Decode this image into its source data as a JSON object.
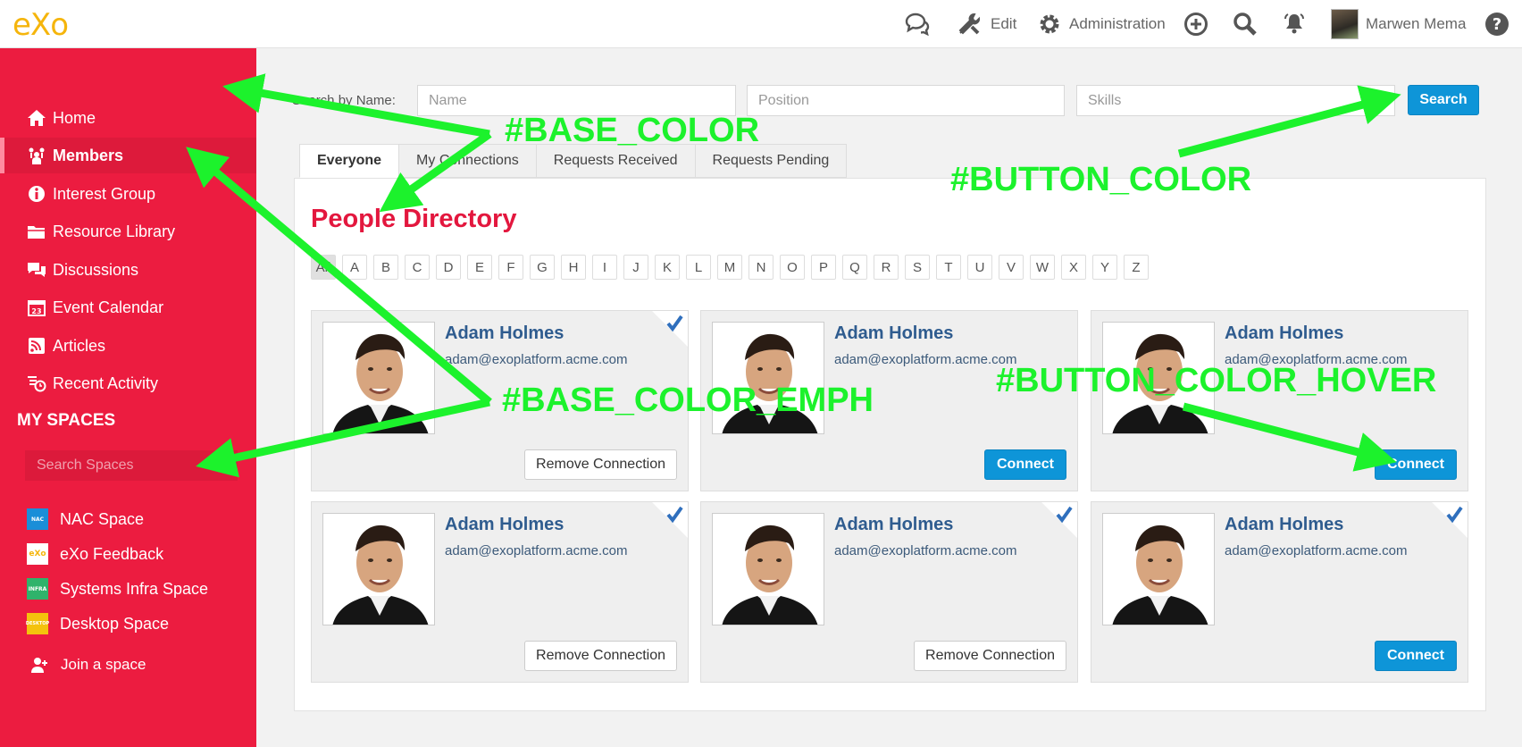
{
  "topbar": {
    "logo": "eXo",
    "edit_label": "Edit",
    "admin_label": "Administration",
    "user_name": "Marwen Mema",
    "icons": [
      "chat-icon",
      "tools-icon",
      "gear-icon",
      "plus-circle-icon",
      "search-icon",
      "bell-icon",
      "avatar",
      "help-icon"
    ]
  },
  "sidebar": {
    "items": [
      {
        "label": "Home",
        "icon": "home-icon"
      },
      {
        "label": "Members",
        "icon": "members-icon",
        "active": true
      },
      {
        "label": "Interest Group",
        "icon": "info-icon"
      },
      {
        "label": "Resource Library",
        "icon": "folder-icon"
      },
      {
        "label": "Discussions",
        "icon": "discussion-icon"
      },
      {
        "label": "Event Calendar",
        "icon": "calendar-icon"
      },
      {
        "label": "Articles",
        "icon": "rss-icon"
      },
      {
        "label": "Recent Activity",
        "icon": "activity-icon"
      }
    ],
    "my_spaces_title": "MY SPACES",
    "search_placeholder": "Search Spaces",
    "spaces": [
      {
        "label": "NAC Space",
        "badge": "NAC",
        "color": "#1a8ed8"
      },
      {
        "label": "eXo Feedback",
        "badge": "eXo",
        "color": "#ffffff"
      },
      {
        "label": "Systems Infra Space",
        "badge": "INFRA",
        "color": "#2fb36b"
      },
      {
        "label": "Desktop Space",
        "badge": "DESKTOP",
        "color": "#f4c20d"
      }
    ],
    "join_label": "Join a space"
  },
  "search": {
    "label": "Search by Name:",
    "name_placeholder": "Name",
    "position_placeholder": "Position",
    "skills_placeholder": "Skills",
    "button": "Search"
  },
  "tabs": [
    {
      "label": "Everyone",
      "active": true
    },
    {
      "label": "My Connections"
    },
    {
      "label": "Requests Received"
    },
    {
      "label": "Requests Pending"
    }
  ],
  "directory": {
    "title": "People Directory",
    "letters": [
      "All",
      "A",
      "B",
      "C",
      "D",
      "E",
      "F",
      "G",
      "H",
      "I",
      "J",
      "K",
      "L",
      "M",
      "N",
      "O",
      "P",
      "Q",
      "R",
      "S",
      "T",
      "U",
      "V",
      "W",
      "X",
      "Y",
      "Z"
    ],
    "people": [
      {
        "name": "Adam Holmes",
        "email": "adam@exoplatform.acme.com",
        "connected": true,
        "button": "Remove Connection"
      },
      {
        "name": "Adam Holmes",
        "email": "adam@exoplatform.acme.com",
        "connected": false,
        "button": "Connect"
      },
      {
        "name": "Adam Holmes",
        "email": "adam@exoplatform.acme.com",
        "connected": false,
        "button": "Connect"
      },
      {
        "name": "Adam Holmes",
        "email": "adam@exoplatform.acme.com",
        "connected": true,
        "button": "Remove Connection"
      },
      {
        "name": "Adam Holmes",
        "email": "adam@exoplatform.acme.com",
        "connected": true,
        "button": "Remove Connection"
      },
      {
        "name": "Adam Holmes",
        "email": "adam@exoplatform.acme.com",
        "connected": true,
        "button": "Connect"
      }
    ]
  },
  "annotations": {
    "base_color": "#BASE_COLOR",
    "button_color": "#BUTTON_COLOR",
    "base_color_emph": "#BASE_COLOR_EMPH",
    "button_color_hover": "#BUTTON_COLOR_HOVER",
    "annotation_color": "#1cf22c"
  },
  "colors": {
    "base": "#ec1c40",
    "base_emph": "#dc1a3b",
    "button": "#0e95d8",
    "button_hover": "#0b7fc0",
    "title": "#e3173e",
    "name_link": "#2f5c8f"
  }
}
